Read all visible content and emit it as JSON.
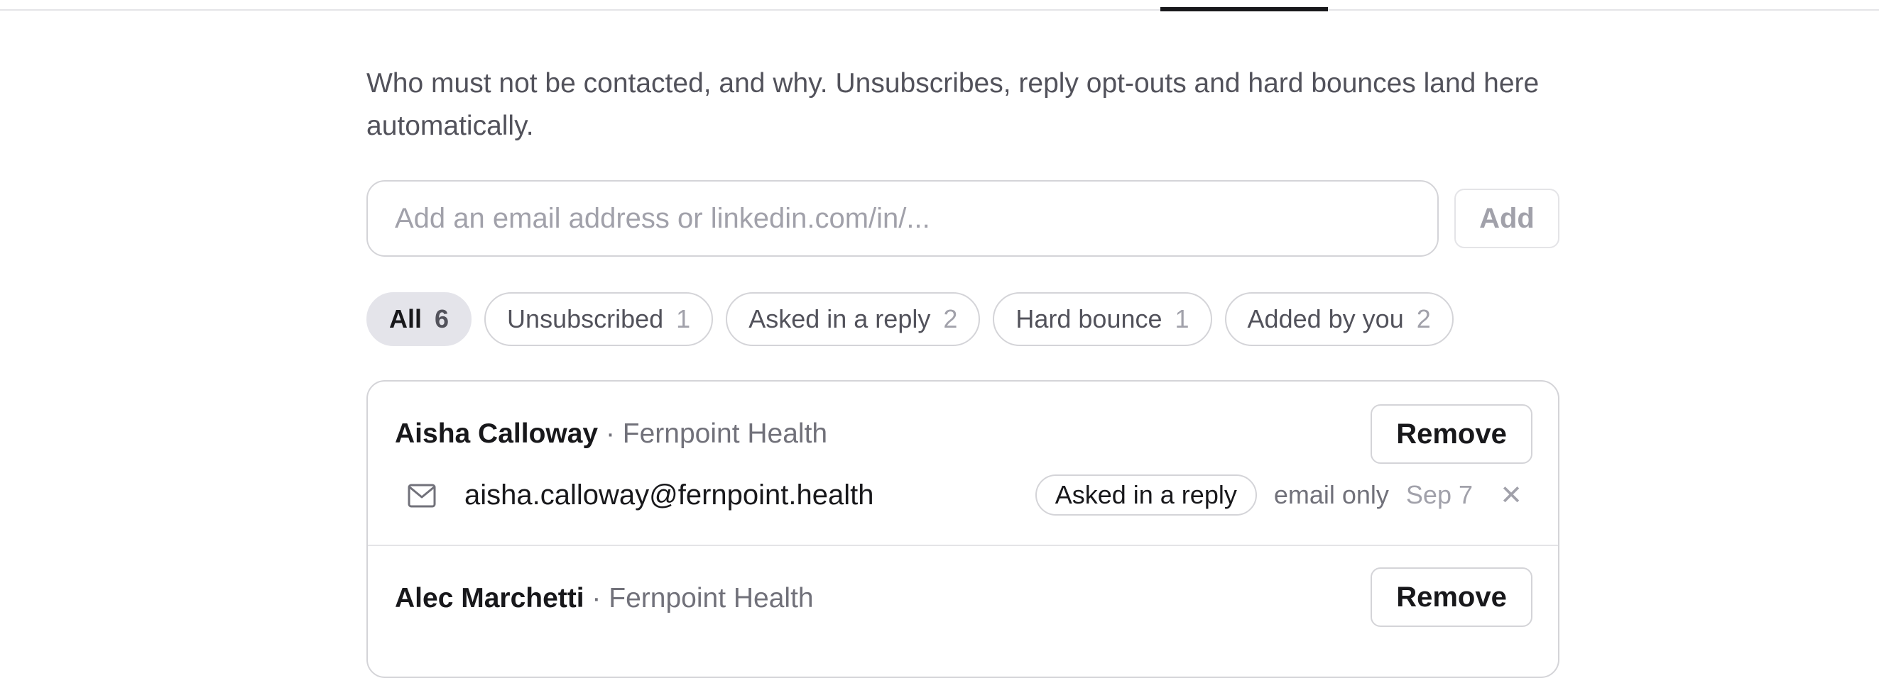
{
  "description": "Who must not be contacted, and why. Unsubscribes, reply opt-outs and hard bounces land here automatically.",
  "add_form": {
    "placeholder": "Add an email address or linkedin.com/in/...",
    "value": "",
    "button_label": "Add"
  },
  "filters": [
    {
      "label": "All",
      "count": "6",
      "active": true
    },
    {
      "label": "Unsubscribed",
      "count": "1",
      "active": false
    },
    {
      "label": "Asked in a reply",
      "count": "2",
      "active": false
    },
    {
      "label": "Hard bounce",
      "count": "1",
      "active": false
    },
    {
      "label": "Added by you",
      "count": "2",
      "active": false
    }
  ],
  "entries": [
    {
      "name": "Aisha Calloway",
      "company_separator": " · ",
      "company": "Fernpoint Health",
      "remove_label": "Remove",
      "contact": {
        "icon": "mail-icon",
        "value": "aisha.calloway@fernpoint.health",
        "reason": "Asked in a reply",
        "scope": "email only",
        "date": "Sep 7",
        "dismiss_glyph": "✕"
      }
    },
    {
      "name": "Alec Marchetti",
      "company_separator": " · ",
      "company": "Fernpoint Health",
      "remove_label": "Remove"
    }
  ]
}
